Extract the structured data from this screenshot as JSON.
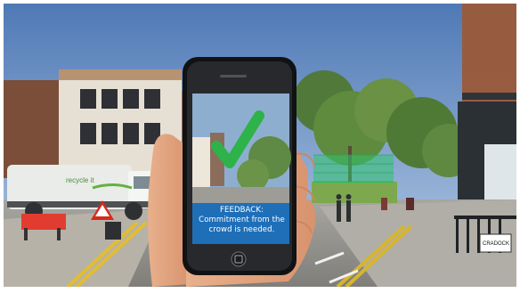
{
  "scene": {
    "feedback_title": "FEEDBACK:",
    "feedback_line_1": "Commitment from the",
    "feedback_line_2": "crowd is needed.",
    "truck_text": "recycle it",
    "sign_text": "CRADOCK",
    "colors": {
      "sky": "#6f8fc0",
      "screen_blue": "#1f6fb8",
      "check_green": "#2eb24a",
      "brick": "#9a5a3a",
      "road": "#9a9a96"
    }
  }
}
